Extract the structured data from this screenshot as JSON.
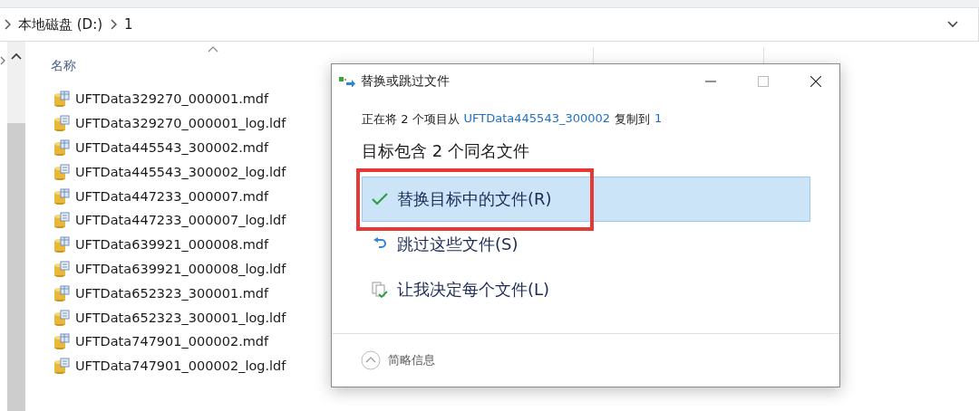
{
  "breadcrumb": [
    {
      "label": "本地磁盘 (D:)"
    },
    {
      "label": "1"
    }
  ],
  "columns": [
    {
      "label": "名称"
    }
  ],
  "files": [
    {
      "name": "UFTData329270_000001.mdf",
      "kind": "mdf"
    },
    {
      "name": "UFTData329270_000001_log.ldf",
      "kind": "ldf"
    },
    {
      "name": "UFTData445543_300002.mdf",
      "kind": "mdf"
    },
    {
      "name": "UFTData445543_300002_log.ldf",
      "kind": "ldf"
    },
    {
      "name": "UFTData447233_000007.mdf",
      "kind": "mdf"
    },
    {
      "name": "UFTData447233_000007_log.ldf",
      "kind": "ldf"
    },
    {
      "name": "UFTData639921_000008.mdf",
      "kind": "mdf"
    },
    {
      "name": "UFTData639921_000008_log.ldf",
      "kind": "ldf"
    },
    {
      "name": "UFTData652323_300001.mdf",
      "kind": "mdf"
    },
    {
      "name": "UFTData652323_300001_log.ldf",
      "kind": "ldf"
    },
    {
      "name": "UFTData747901_000002.mdf",
      "kind": "mdf"
    },
    {
      "name": "UFTData747901_000002_log.ldf",
      "kind": "ldf"
    }
  ],
  "dialog": {
    "title": "替换或跳过文件",
    "copy_line": {
      "prefix": "正在将 2 个项目从",
      "source": "UFTData445543_300002",
      "middle": "复制到",
      "destination": "1"
    },
    "heading": "目标包含 2 个同名文件",
    "options": [
      {
        "kind": "replace",
        "label": "替换目标中的文件(R)",
        "selected": true,
        "outlined": true
      },
      {
        "kind": "skip",
        "label": "跳过这些文件(S)",
        "selected": false,
        "outlined": false
      },
      {
        "kind": "decide",
        "label": "让我决定每个文件(L)",
        "selected": false,
        "outlined": false
      }
    ],
    "details_toggle": "简略信息"
  }
}
